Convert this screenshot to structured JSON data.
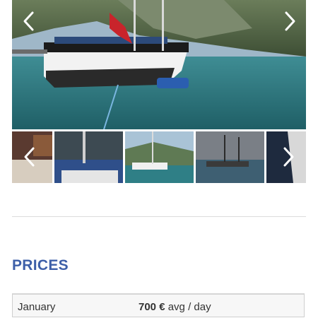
{
  "gallery": {
    "main_image": "boat-photo",
    "prev_icon": "chevron-left-icon",
    "next_icon": "chevron-right-icon",
    "thumbnails": [
      "boat-interior",
      "boat-deck",
      "boat-bay",
      "boat-sunset",
      "boat-sail"
    ]
  },
  "prices": {
    "heading": "PRICES",
    "rows": [
      {
        "month": "January",
        "value": "700 €",
        "unit": " avg / day"
      }
    ]
  },
  "colors": {
    "heading": "#3d5fa8",
    "sea": "#2f7f86",
    "hull": "#2a2a2a"
  }
}
